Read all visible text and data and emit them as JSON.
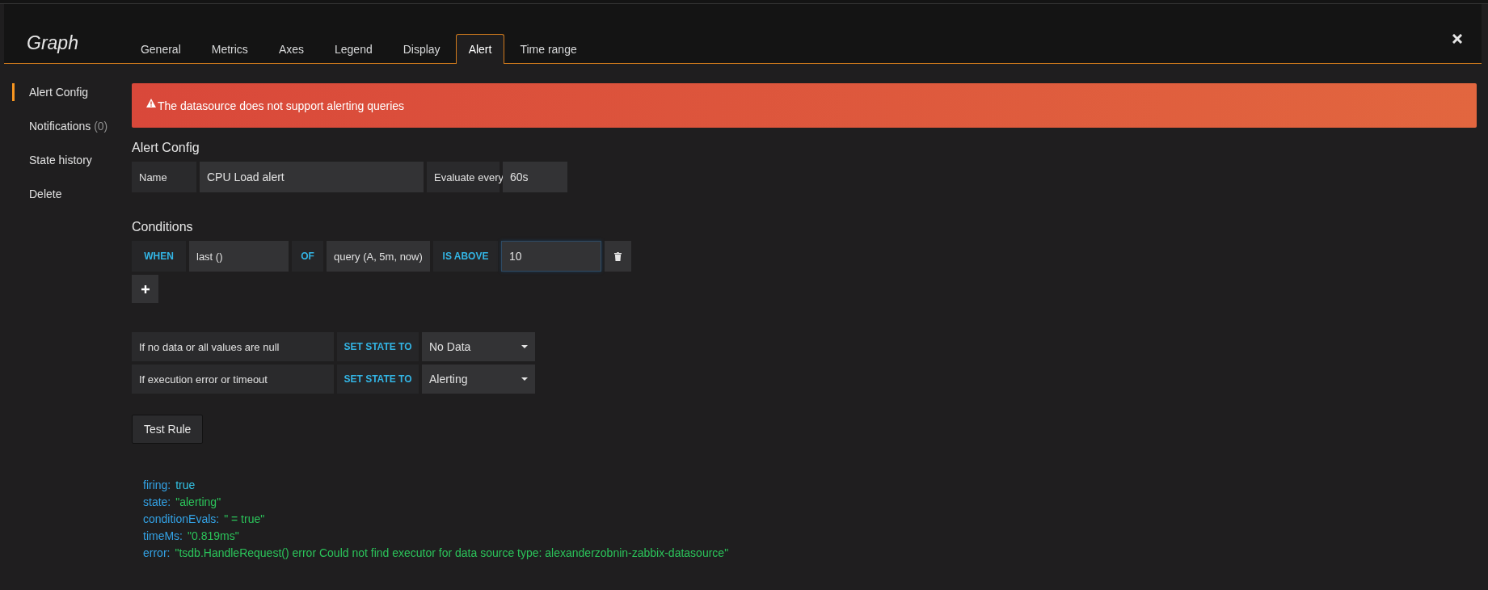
{
  "panel": {
    "title": "Graph"
  },
  "tabs": [
    {
      "label": "General",
      "selected": false
    },
    {
      "label": "Metrics",
      "selected": false
    },
    {
      "label": "Axes",
      "selected": false
    },
    {
      "label": "Legend",
      "selected": false
    },
    {
      "label": "Display",
      "selected": false
    },
    {
      "label": "Alert",
      "selected": true
    },
    {
      "label": "Time range",
      "selected": false
    }
  ],
  "sidebar": {
    "items": [
      {
        "label": "Alert Config",
        "selected": true
      },
      {
        "label": "Notifications",
        "count": "(0)",
        "selected": false
      },
      {
        "label": "State history",
        "selected": false
      },
      {
        "label": "Delete",
        "selected": false
      }
    ]
  },
  "alert_banner": {
    "message": "The datasource does not support alerting queries"
  },
  "alert_config": {
    "heading": "Alert Config",
    "name_label": "Name",
    "name_value": "CPU Load alert",
    "evaluate_label": "Evaluate every",
    "evaluate_value": "60s"
  },
  "conditions": {
    "heading": "Conditions",
    "rows": [
      {
        "when": "WHEN",
        "reducer": "last ()",
        "of": "OF",
        "query": "query (A, 5m, now)",
        "evaluator": "IS ABOVE",
        "threshold": "10"
      }
    ]
  },
  "state_rules": [
    {
      "condition": "If no data or all values are null",
      "action": "SET STATE TO",
      "value": "No Data"
    },
    {
      "condition": "If execution error or timeout",
      "action": "SET STATE TO",
      "value": "Alerting"
    }
  ],
  "test_button": "Test Rule",
  "result": [
    {
      "key": "firing:",
      "value": "true",
      "kind": "boolean"
    },
    {
      "key": "state:",
      "value": "\"alerting\"",
      "kind": "string"
    },
    {
      "key": "conditionEvals:",
      "value": "\" = true\"",
      "kind": "string"
    },
    {
      "key": "timeMs:",
      "value": "\"0.819ms\"",
      "kind": "string"
    },
    {
      "key": "error:",
      "value": "\"tsdb.HandleRequest() error Could not find executor for data source type: alexanderzobnin-zabbix-datasource\"",
      "kind": "string"
    }
  ]
}
